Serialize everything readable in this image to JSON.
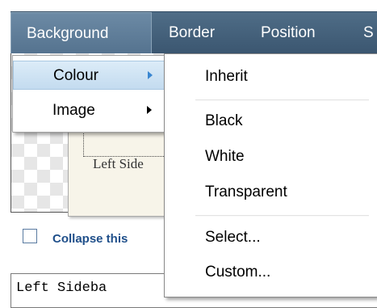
{
  "menubar": {
    "tabs": [
      {
        "label": "Background",
        "active": true
      },
      {
        "label": "Border"
      },
      {
        "label": "Position"
      },
      {
        "label": "S"
      }
    ]
  },
  "preview": {
    "sidebar_text": "Left Side"
  },
  "collapse": {
    "label": "Collapse this"
  },
  "text_field": {
    "value": "Left Sideba"
  },
  "menu": {
    "items": [
      {
        "label": "Colour",
        "has_submenu": true,
        "highlighted": true
      },
      {
        "label": "Image",
        "has_submenu": true
      }
    ]
  },
  "colour_submenu": {
    "items": [
      {
        "label": "Inherit"
      },
      {
        "label": "Black"
      },
      {
        "label": "White"
      },
      {
        "label": "Transparent"
      },
      {
        "label": "Select..."
      },
      {
        "label": "Custom..."
      }
    ]
  },
  "colors": {
    "menubar": "#4a6682",
    "highlight": "#c3dbef",
    "collapse_label": "#1f4f8a",
    "submenu_arrow_active": "#3a87d1"
  }
}
